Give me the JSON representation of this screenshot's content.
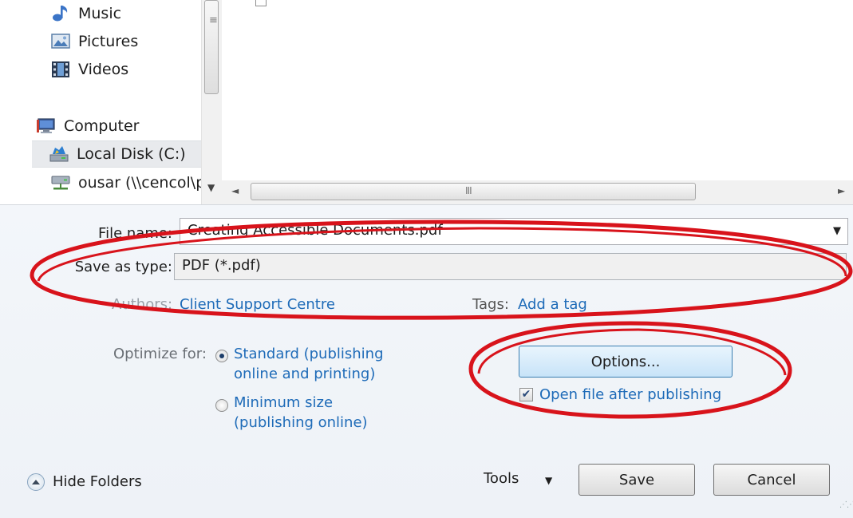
{
  "navigation": {
    "items": [
      {
        "label": "Music",
        "icon": "music-icon"
      },
      {
        "label": "Pictures",
        "icon": "pictures-icon"
      },
      {
        "label": "Videos",
        "icon": "videos-icon"
      },
      {
        "label": "Computer",
        "icon": "computer-icon"
      },
      {
        "label": "Local Disk (C:)",
        "icon": "local-disk-icon",
        "selected": true
      },
      {
        "label": "ousar (\\\\cencol\\p",
        "icon": "network-drive-icon"
      }
    ]
  },
  "form": {
    "file_name_label": "File name:",
    "file_name_value": "Creating Accessible Documents.pdf",
    "save_as_type_label": "Save as type:",
    "save_as_type_value": "PDF (*.pdf)",
    "authors_label": "Authors:",
    "authors_value": "Client Support Centre",
    "tags_label": "Tags:",
    "tags_value": "Add a tag"
  },
  "optimize": {
    "label": "Optimize for:",
    "options": [
      {
        "line1": "Standard (publishing",
        "line2": "online and printing)",
        "selected": true
      },
      {
        "line1": "Minimum size",
        "line2": "(publishing online)",
        "selected": false
      }
    ]
  },
  "options_button_label": "Options...",
  "open_after_publishing": {
    "label": "Open file after publishing",
    "checked": true
  },
  "footer": {
    "hide_folders_label": "Hide Folders",
    "tools_label": "Tools",
    "save_label": "Save",
    "cancel_label": "Cancel"
  },
  "colors": {
    "link": "#1e6bb8",
    "annotation": "#d8131b",
    "options_button": "#c7e3f8"
  }
}
